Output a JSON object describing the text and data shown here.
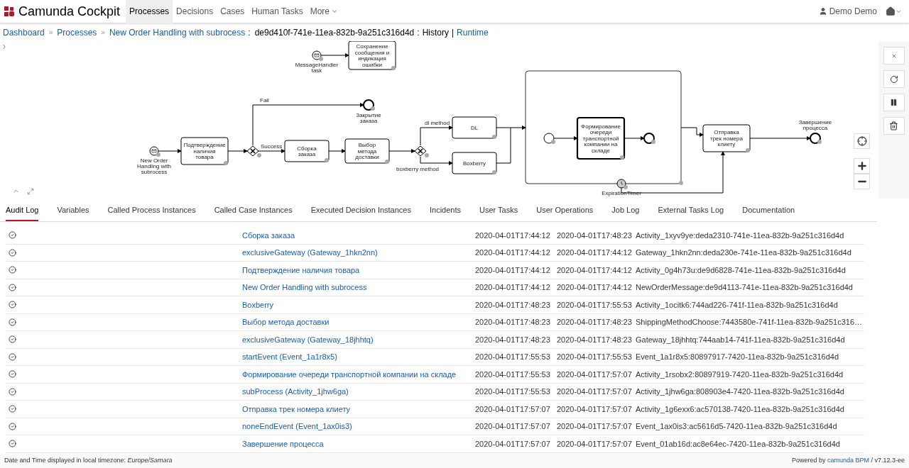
{
  "header": {
    "brand": "Camunda Cockpit",
    "nav": [
      {
        "label": "Processes",
        "selected": true
      },
      {
        "label": "Decisions",
        "selected": false
      },
      {
        "label": "Cases",
        "selected": false
      },
      {
        "label": "Human Tasks",
        "selected": false
      }
    ],
    "more": "More",
    "user": "Demo Demo"
  },
  "breadcrumb": {
    "crumbs": [
      {
        "label": "Dashboard",
        "sep": "»"
      },
      {
        "label": "Processes",
        "sep": "»"
      },
      {
        "label": "New Order Handling with subrocess",
        "sep": ":"
      }
    ],
    "instance": "de9d410f-741e-11ea-832b-9a251c316d4d",
    "sep": ":",
    "view": "History",
    "divider": "|",
    "link": "Runtime"
  },
  "diagram": {
    "tasks": [
      "Подтверждение наличия товара",
      "Сборка заказа",
      "Выбор метода доставки",
      "DL",
      "Boxberry",
      "Формирование очереди транспортной компании на складе",
      "Отправка трек номера клиету",
      "Сохранение сообщения и индикация ошибки"
    ],
    "events": [
      "New Order Handling with subrocess",
      "Закрытие заказа",
      "Завершение процесса",
      "MessageHandler task",
      "ExpirationTimer"
    ],
    "flows": [
      "Fail",
      "Success",
      "dl method",
      "boxberry method"
    ]
  },
  "tabs": [
    {
      "label": "Audit Log",
      "selected": true
    },
    {
      "label": "Variables",
      "selected": false
    },
    {
      "label": "Called Process Instances",
      "selected": false
    },
    {
      "label": "Called Case Instances",
      "selected": false
    },
    {
      "label": "Executed Decision Instances",
      "selected": false
    },
    {
      "label": "Incidents",
      "selected": false
    },
    {
      "label": "User Tasks",
      "selected": false
    },
    {
      "label": "User Operations",
      "selected": false
    },
    {
      "label": "Job Log",
      "selected": false
    },
    {
      "label": "External Tasks Log",
      "selected": false
    },
    {
      "label": "Documentation",
      "selected": false
    }
  ],
  "audit_log": [
    {
      "name": "Сборка заказа",
      "start": "2020-04-01T17:44:12",
      "end": "2020-04-01T17:48:23",
      "id": "Activity_1xyv9ye:deda2310-741e-11ea-832b-9a251c316d4d"
    },
    {
      "name": "exclusiveGateway (Gateway_1hkn2nn)",
      "start": "2020-04-01T17:44:12",
      "end": "2020-04-01T17:44:12",
      "id": "Gateway_1hkn2nn:deda230e-741e-11ea-832b-9a251c316d4d"
    },
    {
      "name": "Подтверждение наличия товара",
      "start": "2020-04-01T17:44:12",
      "end": "2020-04-01T17:44:12",
      "id": "Activity_0g4h73u:de9d6828-741e-11ea-832b-9a251c316d4d"
    },
    {
      "name": "New Order Handling with subrocess",
      "start": "2020-04-01T17:44:12",
      "end": "2020-04-01T17:44:12",
      "id": "NewOrderMessage:de9d4113-741e-11ea-832b-9a251c316d4d"
    },
    {
      "name": "Boxberry",
      "start": "2020-04-01T17:48:23",
      "end": "2020-04-01T17:55:53",
      "id": "Activity_1ocitk6:744ad226-741f-11ea-832b-9a251c316d4d"
    },
    {
      "name": "Выбор метода доставки",
      "start": "2020-04-01T17:48:23",
      "end": "2020-04-01T17:48:23",
      "id": "ShippingMethodChoose:7443580e-741f-11ea-832b-9a251c316…"
    },
    {
      "name": "exclusiveGateway (Gateway_18jhhtq)",
      "start": "2020-04-01T17:48:23",
      "end": "2020-04-01T17:48:23",
      "id": "Gateway_18jhhtq:744aab14-741f-11ea-832b-9a251c316d4d"
    },
    {
      "name": "startEvent (Event_1a1r8x5)",
      "start": "2020-04-01T17:55:53",
      "end": "2020-04-01T17:55:53",
      "id": "Event_1a1r8x5:80897917-7420-11ea-832b-9a251c316d4d"
    },
    {
      "name": "Формирование очереди транспортной компании на складе",
      "start": "2020-04-01T17:55:53",
      "end": "2020-04-01T17:57:07",
      "id": "Activity_1rsobx2:80897919-7420-11ea-832b-9a251c316d4d"
    },
    {
      "name": "subProcess (Activity_1jhw6ga)",
      "start": "2020-04-01T17:55:53",
      "end": "2020-04-01T17:57:07",
      "id": "Activity_1jhw6ga:808903e4-7420-11ea-832b-9a251c316d4d"
    },
    {
      "name": "Отправка трек номера клиету",
      "start": "2020-04-01T17:57:07",
      "end": "2020-04-01T17:57:07",
      "id": "Activity_1g6exx6:ac570138-7420-11ea-832b-9a251c316d4d"
    },
    {
      "name": "noneEndEvent (Event_1ax0is3)",
      "start": "2020-04-01T17:57:07",
      "end": "2020-04-01T17:57:07",
      "id": "Event_1ax0is3:ac5616d5-7420-11ea-832b-9a251c316d4d"
    },
    {
      "name": "Завершение процесса",
      "start": "2020-04-01T17:57:07",
      "end": "2020-04-01T17:57:07",
      "id": "Event_01ab16d:ac8e64ec-7420-11ea-832b-9a251c316d4d"
    }
  ],
  "footer": {
    "timezone": "Date and Time displayed in local timezone: *Europe/Samara*",
    "powered": "Powered by",
    "brand_link": "camunda BPM",
    "version": "/ v7.12.3-ee"
  }
}
